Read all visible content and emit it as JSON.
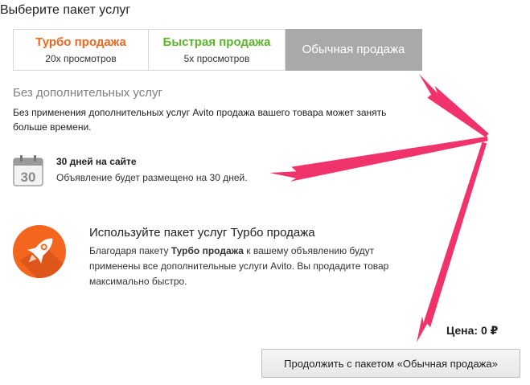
{
  "page": {
    "title": "Выберите пакет услуг"
  },
  "tabs": [
    {
      "title": "Турбо продажа",
      "subtitle": "20х просмотров",
      "color": "#f4661e"
    },
    {
      "title": "Быстрая продажа",
      "subtitle": "5х просмотров",
      "color": "#5ab52b"
    },
    {
      "title": "Обычная продажа",
      "subtitle": "",
      "selected": true
    }
  ],
  "section": {
    "title": "Без дополнительных услуг",
    "description": "Без применения дополнительных услуг Avito продажа вашего товара может занять больше времени."
  },
  "listing": {
    "calendar_number": "30",
    "title": "30 дней на сайте",
    "description": "Объявление будет размещено на 30 дней."
  },
  "promo": {
    "title": "Используйте пакет услуг Турбо продажа",
    "desc_before": "Благодаря пакету ",
    "desc_bold": "Турбо продажа",
    "desc_after": " к вашему объявлению будут применены все дополнительные услуги Avito. Вы продадите товар максимально быстро."
  },
  "price": {
    "label": "Цена: 0 ₽"
  },
  "continue_button": {
    "label": "Продолжить с пакетом «Обычная продажа»"
  },
  "colors": {
    "arrow": "#f0346b",
    "turbo": "#f4661e",
    "fast": "#5ab52b",
    "selected_tab": "#a9a9a9"
  }
}
